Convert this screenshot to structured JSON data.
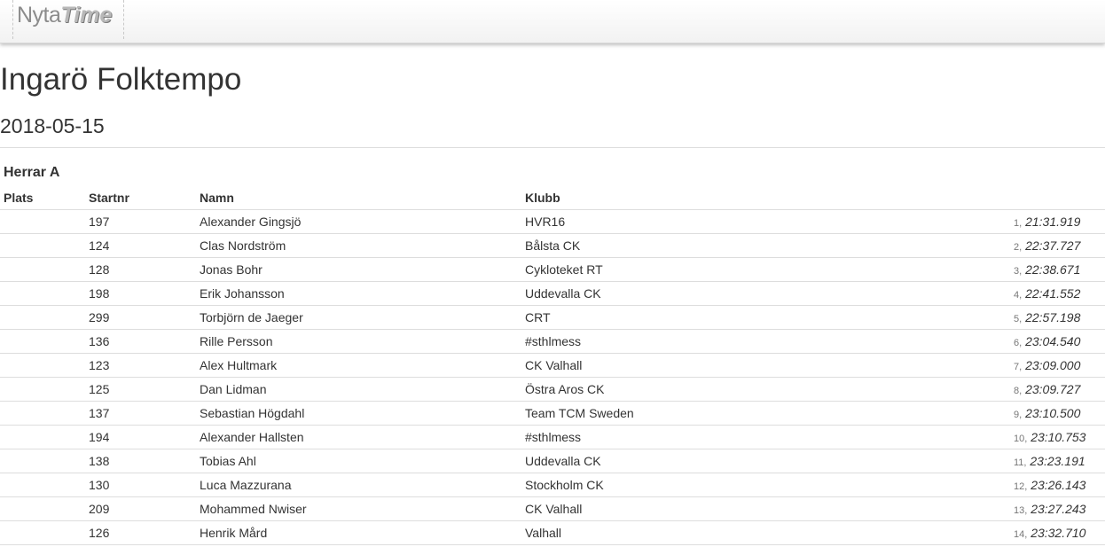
{
  "navbar": {
    "logo_part1": "Nyta",
    "logo_part2": "Time"
  },
  "event": {
    "title": "Ingarö Folktempo",
    "date": "2018-05-15"
  },
  "race_class": "Herrar A",
  "table": {
    "headers": {
      "plats": "Plats",
      "startnr": "Startnr",
      "namn": "Namn",
      "klubb": "Klubb"
    },
    "rows": [
      {
        "plats": "",
        "startnr": "197",
        "namn": "Alexander Gingsjö",
        "klubb": "HVR16",
        "rank": "1,",
        "time": "21:31.919"
      },
      {
        "plats": "",
        "startnr": "124",
        "namn": "Clas Nordström",
        "klubb": "Bålsta CK",
        "rank": "2,",
        "time": "22:37.727"
      },
      {
        "plats": "",
        "startnr": "128",
        "namn": "Jonas Bohr",
        "klubb": "Cykloteket RT",
        "rank": "3,",
        "time": "22:38.671"
      },
      {
        "plats": "",
        "startnr": "198",
        "namn": "Erik Johansson",
        "klubb": "Uddevalla CK",
        "rank": "4,",
        "time": "22:41.552"
      },
      {
        "plats": "",
        "startnr": "299",
        "namn": "Torbjörn de Jaeger",
        "klubb": "CRT",
        "rank": "5,",
        "time": "22:57.198"
      },
      {
        "plats": "",
        "startnr": "136",
        "namn": "Rille Persson",
        "klubb": "#sthlmess",
        "rank": "6,",
        "time": "23:04.540"
      },
      {
        "plats": "",
        "startnr": "123",
        "namn": "Alex Hultmark",
        "klubb": "CK Valhall",
        "rank": "7,",
        "time": "23:09.000"
      },
      {
        "plats": "",
        "startnr": "125",
        "namn": "Dan Lidman",
        "klubb": "Östra Aros CK",
        "rank": "8,",
        "time": "23:09.727"
      },
      {
        "plats": "",
        "startnr": "137",
        "namn": "Sebastian Högdahl",
        "klubb": "Team TCM Sweden",
        "rank": "9,",
        "time": "23:10.500"
      },
      {
        "plats": "",
        "startnr": "194",
        "namn": "Alexander Hallsten",
        "klubb": "#sthlmess",
        "rank": "10,",
        "time": "23:10.753"
      },
      {
        "plats": "",
        "startnr": "138",
        "namn": "Tobias Ahl",
        "klubb": "Uddevalla CK",
        "rank": "11,",
        "time": "23:23.191"
      },
      {
        "plats": "",
        "startnr": "130",
        "namn": "Luca Mazzurana",
        "klubb": "Stockholm CK",
        "rank": "12,",
        "time": "23:26.143"
      },
      {
        "plats": "",
        "startnr": "209",
        "namn": "Mohammed Nwiser",
        "klubb": "CK Valhall",
        "rank": "13,",
        "time": "23:27.243"
      },
      {
        "plats": "",
        "startnr": "126",
        "namn": "Henrik Mård",
        "klubb": "Valhall",
        "rank": "14,",
        "time": "23:32.710"
      }
    ]
  }
}
